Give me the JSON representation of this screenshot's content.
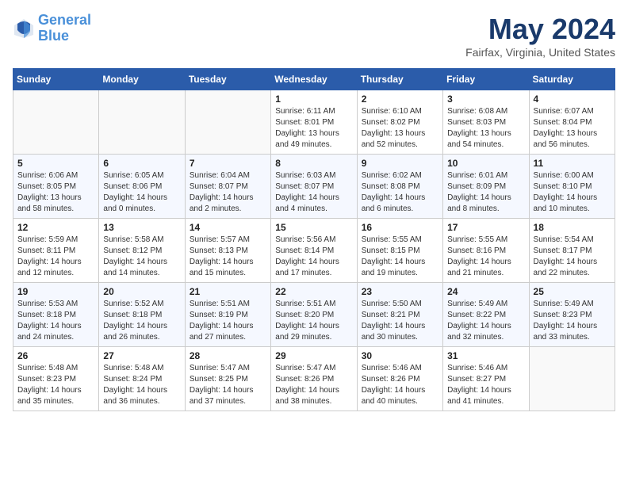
{
  "header": {
    "logo_line1": "General",
    "logo_line2": "Blue",
    "month": "May 2024",
    "location": "Fairfax, Virginia, United States"
  },
  "weekdays": [
    "Sunday",
    "Monday",
    "Tuesday",
    "Wednesday",
    "Thursday",
    "Friday",
    "Saturday"
  ],
  "weeks": [
    [
      {
        "day": "",
        "info": ""
      },
      {
        "day": "",
        "info": ""
      },
      {
        "day": "",
        "info": ""
      },
      {
        "day": "1",
        "info": "Sunrise: 6:11 AM\nSunset: 8:01 PM\nDaylight: 13 hours\nand 49 minutes."
      },
      {
        "day": "2",
        "info": "Sunrise: 6:10 AM\nSunset: 8:02 PM\nDaylight: 13 hours\nand 52 minutes."
      },
      {
        "day": "3",
        "info": "Sunrise: 6:08 AM\nSunset: 8:03 PM\nDaylight: 13 hours\nand 54 minutes."
      },
      {
        "day": "4",
        "info": "Sunrise: 6:07 AM\nSunset: 8:04 PM\nDaylight: 13 hours\nand 56 minutes."
      }
    ],
    [
      {
        "day": "5",
        "info": "Sunrise: 6:06 AM\nSunset: 8:05 PM\nDaylight: 13 hours\nand 58 minutes."
      },
      {
        "day": "6",
        "info": "Sunrise: 6:05 AM\nSunset: 8:06 PM\nDaylight: 14 hours\nand 0 minutes."
      },
      {
        "day": "7",
        "info": "Sunrise: 6:04 AM\nSunset: 8:07 PM\nDaylight: 14 hours\nand 2 minutes."
      },
      {
        "day": "8",
        "info": "Sunrise: 6:03 AM\nSunset: 8:07 PM\nDaylight: 14 hours\nand 4 minutes."
      },
      {
        "day": "9",
        "info": "Sunrise: 6:02 AM\nSunset: 8:08 PM\nDaylight: 14 hours\nand 6 minutes."
      },
      {
        "day": "10",
        "info": "Sunrise: 6:01 AM\nSunset: 8:09 PM\nDaylight: 14 hours\nand 8 minutes."
      },
      {
        "day": "11",
        "info": "Sunrise: 6:00 AM\nSunset: 8:10 PM\nDaylight: 14 hours\nand 10 minutes."
      }
    ],
    [
      {
        "day": "12",
        "info": "Sunrise: 5:59 AM\nSunset: 8:11 PM\nDaylight: 14 hours\nand 12 minutes."
      },
      {
        "day": "13",
        "info": "Sunrise: 5:58 AM\nSunset: 8:12 PM\nDaylight: 14 hours\nand 14 minutes."
      },
      {
        "day": "14",
        "info": "Sunrise: 5:57 AM\nSunset: 8:13 PM\nDaylight: 14 hours\nand 15 minutes."
      },
      {
        "day": "15",
        "info": "Sunrise: 5:56 AM\nSunset: 8:14 PM\nDaylight: 14 hours\nand 17 minutes."
      },
      {
        "day": "16",
        "info": "Sunrise: 5:55 AM\nSunset: 8:15 PM\nDaylight: 14 hours\nand 19 minutes."
      },
      {
        "day": "17",
        "info": "Sunrise: 5:55 AM\nSunset: 8:16 PM\nDaylight: 14 hours\nand 21 minutes."
      },
      {
        "day": "18",
        "info": "Sunrise: 5:54 AM\nSunset: 8:17 PM\nDaylight: 14 hours\nand 22 minutes."
      }
    ],
    [
      {
        "day": "19",
        "info": "Sunrise: 5:53 AM\nSunset: 8:18 PM\nDaylight: 14 hours\nand 24 minutes."
      },
      {
        "day": "20",
        "info": "Sunrise: 5:52 AM\nSunset: 8:18 PM\nDaylight: 14 hours\nand 26 minutes."
      },
      {
        "day": "21",
        "info": "Sunrise: 5:51 AM\nSunset: 8:19 PM\nDaylight: 14 hours\nand 27 minutes."
      },
      {
        "day": "22",
        "info": "Sunrise: 5:51 AM\nSunset: 8:20 PM\nDaylight: 14 hours\nand 29 minutes."
      },
      {
        "day": "23",
        "info": "Sunrise: 5:50 AM\nSunset: 8:21 PM\nDaylight: 14 hours\nand 30 minutes."
      },
      {
        "day": "24",
        "info": "Sunrise: 5:49 AM\nSunset: 8:22 PM\nDaylight: 14 hours\nand 32 minutes."
      },
      {
        "day": "25",
        "info": "Sunrise: 5:49 AM\nSunset: 8:23 PM\nDaylight: 14 hours\nand 33 minutes."
      }
    ],
    [
      {
        "day": "26",
        "info": "Sunrise: 5:48 AM\nSunset: 8:23 PM\nDaylight: 14 hours\nand 35 minutes."
      },
      {
        "day": "27",
        "info": "Sunrise: 5:48 AM\nSunset: 8:24 PM\nDaylight: 14 hours\nand 36 minutes."
      },
      {
        "day": "28",
        "info": "Sunrise: 5:47 AM\nSunset: 8:25 PM\nDaylight: 14 hours\nand 37 minutes."
      },
      {
        "day": "29",
        "info": "Sunrise: 5:47 AM\nSunset: 8:26 PM\nDaylight: 14 hours\nand 38 minutes."
      },
      {
        "day": "30",
        "info": "Sunrise: 5:46 AM\nSunset: 8:26 PM\nDaylight: 14 hours\nand 40 minutes."
      },
      {
        "day": "31",
        "info": "Sunrise: 5:46 AM\nSunset: 8:27 PM\nDaylight: 14 hours\nand 41 minutes."
      },
      {
        "day": "",
        "info": ""
      }
    ]
  ]
}
